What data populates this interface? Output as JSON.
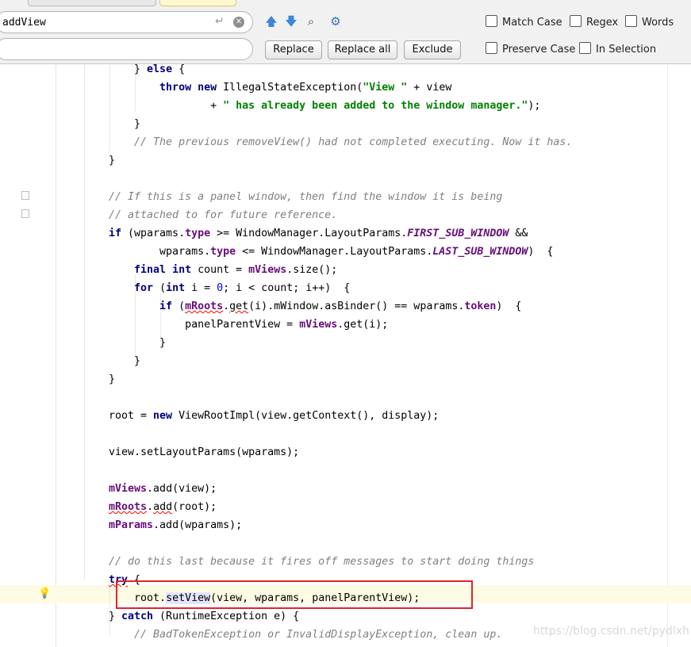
{
  "find_bar": {
    "search_value": "addView",
    "replace_value": "",
    "enter_glyph": "↵",
    "clear_glyph": "✕",
    "icons": [
      {
        "name": "previous-occurrence-icon",
        "glyph": "🡅",
        "color": "#3d86d8"
      },
      {
        "name": "next-occurrence-icon",
        "glyph": "🡇",
        "color": "#3d86d8"
      },
      {
        "name": "find-all-icon",
        "glyph": "⌕",
        "color": "#4a4a4a"
      },
      {
        "name": "filter-settings-icon",
        "glyph": "⚙",
        "color": "#3d6fb5"
      }
    ],
    "buttons": {
      "replace": "Replace",
      "replace_all": "Replace all",
      "exclude": "Exclude"
    },
    "options": {
      "match_case": "Match Case",
      "regex": "Regex",
      "words": "Words",
      "preserve_case": "Preserve Case",
      "in_selection": "In Selection"
    }
  },
  "code": {
    "indents": {
      "l1": "    ",
      "l2": "        ",
      "l3": "            ",
      "l4": "                "
    },
    "t": {
      "else_close": "} ",
      "else_kw": "else",
      "open": " {",
      "throw": "throw",
      "new": "new",
      "ise": " IllegalStateException(",
      "str_view": "\"View \"",
      "plus_view": " + view",
      "plus": "+ ",
      "str_added": "\" has already been added to the window manager.\"",
      "close_paren_semi": ");",
      "rbrace": "}",
      "cmt_previous": "// The previous removeView() had not completed executing. Now it has.",
      "cmt_panel1": "// If this is a panel window, then find the window it is being",
      "cmt_panel2": "// attached to for future reference.",
      "if": "if",
      "paren_wparams": " (wparams.",
      "type": "type",
      "ge_wm": " >= WindowManager.LayoutParams.",
      "first_sub": "FIRST_SUB_WINDOW",
      "andand": " &&",
      "wparams_dot": "wparams.",
      "le_wm": " <= WindowManager.LayoutParams.",
      "last_sub": "LAST_SUB_WINDOW",
      "paren_open": ")  {",
      "final": "final",
      "int": "int",
      "count_eq": " count = ",
      "mViews": "mViews",
      "size_call": ".size();",
      "for": "for",
      "for_a": " (",
      "i_eq": " i = ",
      "zero": "0",
      "for_b": "; i < count; i++)  {",
      "paren": " (",
      "mRoots": "mRoots",
      "dot": ".",
      "get": "get",
      "mwindow_cond": "(i).mWindow.asBinder() == wparams.",
      "token": "token",
      "close_open": ")  {",
      "panel_assign": "panelParentView = ",
      "get_i": ".get(i);",
      "root_eq": "root = ",
      "vri": " ViewRootImpl(view.getContext(), display);",
      "set_layout": "view.setLayoutParams(wparams);",
      "add_view": ".add(view);",
      "add": "add",
      "root_close": "(root);",
      "mParams": "mParams",
      "add_wparams": ".add(wparams);",
      "cmt_last": "// do this last because it fires off messages to start doing things",
      "try": "try",
      "root_dot": "root.",
      "setView": "setView",
      "setview_args": "(view, wparams, panelParentView);",
      "catch_close": "} ",
      "catch": "catch",
      "rte": " (RuntimeException e) {",
      "cmt_badtoken": "// BadTokenException or InvalidDisplayException, clean up."
    }
  },
  "watermark": "https://blog.csdn.net/pydlxh",
  "colors": {
    "keyword": "#000080",
    "string": "#008000",
    "comment": "#808080",
    "field": "#660e7a",
    "number": "#0000ff",
    "highlight_box": "#e0242a",
    "current_line": "#fffae3"
  }
}
